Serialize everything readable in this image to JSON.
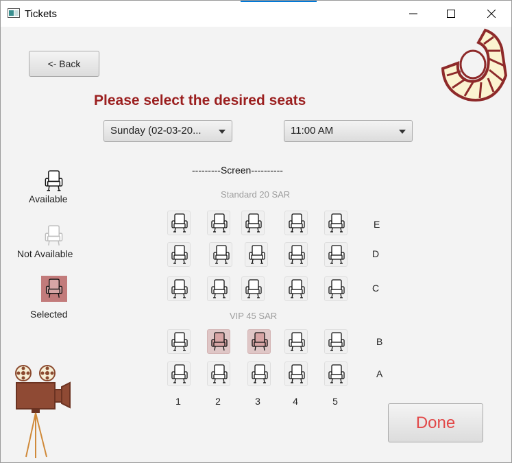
{
  "window": {
    "title": "Tickets"
  },
  "back_button": {
    "label": "<-  Back"
  },
  "heading": "Please select the desired seats",
  "date_select": {
    "value": "Sunday (02-03-20..."
  },
  "time_select": {
    "value": "11:00 AM"
  },
  "screen_label": "---------Screen----------",
  "sections": {
    "standard": "Standard 20 SAR",
    "vip": "VIP 45 SAR"
  },
  "legend": {
    "available": "Available",
    "not_available": "Not Available",
    "selected": "Selected"
  },
  "rows": [
    "E",
    "D",
    "C",
    "B",
    "A"
  ],
  "columns": [
    "1",
    "2",
    "3",
    "4",
    "5"
  ],
  "selected_seats": [
    "B2",
    "B3"
  ],
  "done_button": {
    "label": "Done"
  },
  "colors": {
    "heading": "#9b1f1f",
    "selected_seat": "#dfc6c6",
    "done_text": "#e24848",
    "accent": "#0078d7"
  }
}
